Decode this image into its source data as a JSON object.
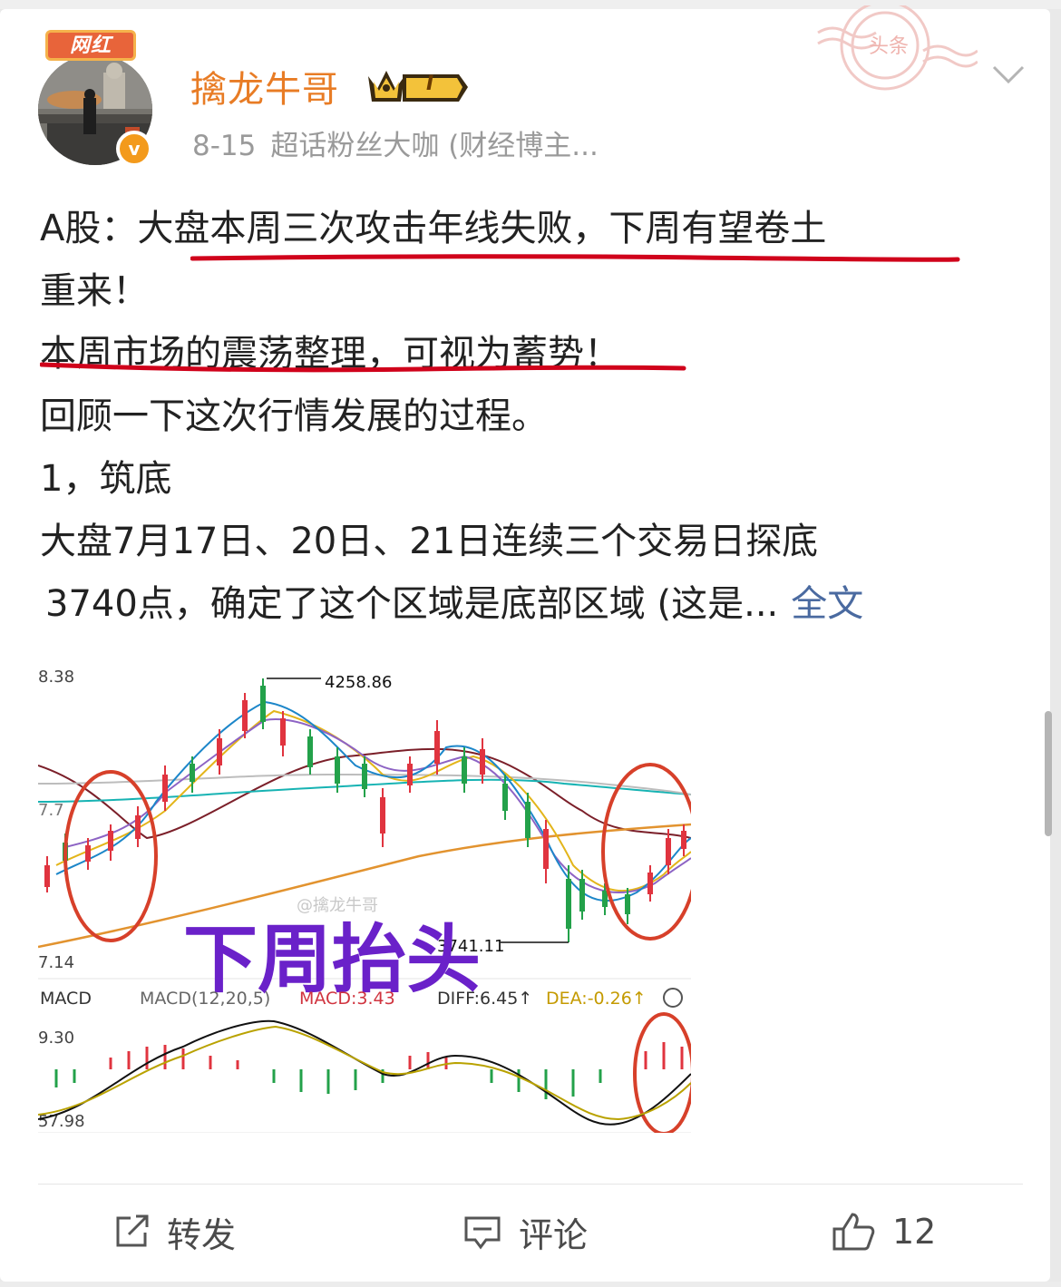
{
  "post": {
    "badge": "网红",
    "username": "擒龙牛哥",
    "level": "I",
    "verified_mark": "v",
    "date": "8-15",
    "source": "超话粉丝大咖 (财经博主...",
    "stamp_text": "头条",
    "body": {
      "line1_prefix": "A股：",
      "line1_main": "大盘本周三次攻击年线失败，下周有望卷土",
      "line2": "重来！",
      "line3_main": "本周市场的震荡整理，可视为蓄势",
      "line3_tail": "！",
      "line4": "回顾一下这次行情发展的过程。",
      "line5": "1，筑底",
      "line6": "大盘7月17日、20日、21日连续三个交易日探底",
      "line7": "3740点，确定了这个区域是底部区域 (这是...",
      "more": "全文"
    },
    "colors": {
      "accent": "#e87c25",
      "underline": "#d0021b",
      "link": "#4a6aa0"
    }
  },
  "chart": {
    "top_left_label": "8.38",
    "mid_left_label": "7.7",
    "bottom_left_label": "7.14",
    "high_label": "4258.86",
    "low_label": "3741.11",
    "watermark": "@擒龙牛哥",
    "overlay_text": "下周抬头",
    "macd_tab": "MACD",
    "macd_params": "MACD(12,20,5)",
    "macd_value": "MACD:3.43",
    "diff_value": "DIFF:6.45↑",
    "dea_value": "DEA:-0.26↑",
    "macd_top": "9.30",
    "macd_bottom": "57.98"
  },
  "actions": {
    "repost": "转发",
    "comment": "评论",
    "likes": "12"
  }
}
